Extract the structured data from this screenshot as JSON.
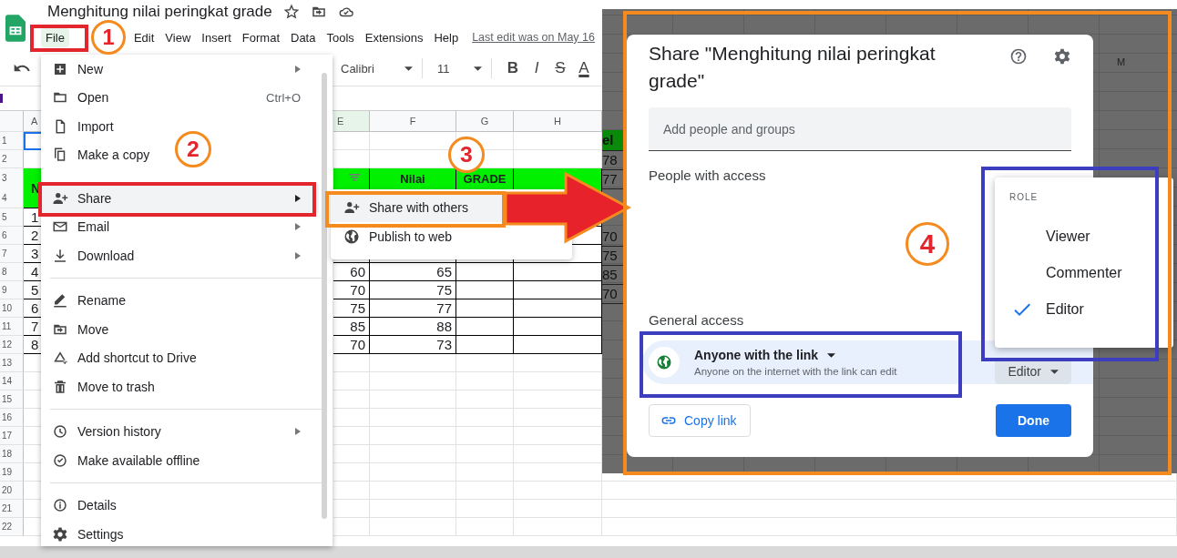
{
  "document": {
    "title": "Menghitung nilai peringkat grade",
    "last_edit": "Last edit was on May 16"
  },
  "menubar": [
    {
      "label": "File",
      "selected": true
    },
    {
      "label": "Edit",
      "selected": false
    },
    {
      "label": "View",
      "selected": false
    },
    {
      "label": "Insert",
      "selected": false
    },
    {
      "label": "Format",
      "selected": false
    },
    {
      "label": "Data",
      "selected": false
    },
    {
      "label": "Tools",
      "selected": false
    },
    {
      "label": "Extensions",
      "selected": false
    },
    {
      "label": "Help",
      "selected": false
    }
  ],
  "toolbar": {
    "font": "Calibri",
    "size": "11",
    "format_buttons": [
      {
        "label": "B",
        "kind": "bold"
      },
      {
        "label": "I",
        "kind": "italic"
      },
      {
        "label": "S",
        "kind": "strike"
      },
      {
        "label": "A",
        "kind": "color"
      }
    ]
  },
  "sheet": {
    "columns": [
      "A",
      "E",
      "F",
      "G",
      "H"
    ],
    "rows": [
      {
        "numbers": [
          "1"
        ],
        "kind": "blank",
        "selected": true,
        "cells": [
          null,
          null,
          null,
          null,
          null
        ]
      },
      {
        "numbers": [
          "2"
        ],
        "kind": "blank",
        "selected": false,
        "cells": [
          null,
          null,
          null,
          null,
          null
        ]
      },
      {
        "numbers": [
          "3",
          "4"
        ],
        "kind": "header",
        "selected": false,
        "filter": true,
        "cells": [
          "N",
          null,
          "Nilai",
          "GRADE",
          null
        ]
      },
      {
        "numbers": [
          "5"
        ],
        "kind": "data",
        "selected": false,
        "cells": [
          "1",
          null,
          null,
          null,
          null
        ]
      },
      {
        "numbers": [
          "6"
        ],
        "kind": "data",
        "selected": false,
        "cells": [
          "2",
          null,
          null,
          null,
          null
        ]
      },
      {
        "numbers": [
          "7"
        ],
        "kind": "data",
        "selected": false,
        "cells": [
          "3",
          null,
          null,
          null,
          null
        ]
      },
      {
        "numbers": [
          "8"
        ],
        "kind": "data",
        "selected": false,
        "cells": [
          "4",
          "60",
          "65",
          null,
          null
        ]
      },
      {
        "numbers": [
          "9"
        ],
        "kind": "data",
        "selected": false,
        "cells": [
          "5",
          "70",
          "75",
          null,
          null
        ]
      },
      {
        "numbers": [
          "10"
        ],
        "kind": "data",
        "selected": false,
        "cells": [
          "6",
          "75",
          "77",
          null,
          null
        ]
      },
      {
        "numbers": [
          "11"
        ],
        "kind": "data",
        "selected": false,
        "cells": [
          "7",
          "85",
          "88",
          null,
          null
        ]
      },
      {
        "numbers": [
          "12"
        ],
        "kind": "data",
        "selected": false,
        "cells": [
          "8",
          "70",
          "73",
          null,
          null
        ]
      },
      {
        "numbers": [
          "13"
        ],
        "kind": "blank",
        "selected": false,
        "cells": [
          null,
          null,
          null,
          null,
          null
        ]
      },
      {
        "numbers": [
          "14"
        ],
        "kind": "blank",
        "selected": false,
        "cells": [
          null,
          null,
          null,
          null,
          null
        ]
      },
      {
        "numbers": [
          "15"
        ],
        "kind": "blank",
        "selected": false,
        "cells": [
          null,
          null,
          null,
          null,
          null
        ]
      },
      {
        "numbers": [
          "16"
        ],
        "kind": "blank",
        "selected": false,
        "cells": [
          null,
          null,
          null,
          null,
          null
        ]
      },
      {
        "numbers": [
          "17"
        ],
        "kind": "blank",
        "selected": false,
        "cells": [
          null,
          null,
          null,
          null,
          null
        ]
      },
      {
        "numbers": [
          "18"
        ],
        "kind": "blank",
        "selected": false,
        "cells": [
          null,
          null,
          null,
          null,
          null
        ]
      },
      {
        "numbers": [
          "19"
        ],
        "kind": "blank",
        "selected": false,
        "cells": [
          null,
          null,
          null,
          null,
          null
        ]
      },
      {
        "numbers": [
          "20"
        ],
        "kind": "blank",
        "selected": false,
        "cells": [
          null,
          null,
          null,
          null,
          null
        ]
      },
      {
        "numbers": [
          "21"
        ],
        "kind": "blank",
        "selected": false,
        "cells": [
          null,
          null,
          null,
          null,
          null
        ]
      },
      {
        "numbers": [
          "22"
        ],
        "kind": "blank",
        "selected": false,
        "cells": [
          null,
          null,
          null,
          null,
          null
        ]
      }
    ]
  },
  "file_menu": [
    {
      "rule": false,
      "items": [
        {
          "label": "New",
          "submenu": true,
          "selected": false
        },
        {
          "label": "Open",
          "shortcut": "Ctrl+O",
          "submenu": false,
          "selected": false
        },
        {
          "label": "Import",
          "submenu": false,
          "selected": false
        },
        {
          "label": "Make a copy",
          "submenu": false,
          "selected": false
        }
      ]
    },
    {
      "rule": false,
      "items": [
        {
          "label": "Share",
          "submenu": true,
          "selected": true
        },
        {
          "label": "Email",
          "submenu": true,
          "selected": false
        },
        {
          "label": "Download",
          "submenu": true,
          "selected": false
        }
      ]
    },
    {
      "rule": true,
      "items": [
        {
          "label": "Rename",
          "submenu": false,
          "selected": false
        },
        {
          "label": "Move",
          "submenu": false,
          "selected": false
        },
        {
          "label": "Add shortcut to Drive",
          "submenu": false,
          "selected": false
        },
        {
          "label": "Move to trash",
          "submenu": false,
          "selected": false
        }
      ]
    },
    {
      "rule": true,
      "items": [
        {
          "label": "Version history",
          "submenu": true,
          "selected": false
        },
        {
          "label": "Make available offline",
          "submenu": false,
          "selected": false
        }
      ]
    },
    {
      "rule": true,
      "items": [
        {
          "label": "Details",
          "submenu": false,
          "selected": false
        },
        {
          "label": "Settings",
          "submenu": false,
          "selected": false
        }
      ]
    }
  ],
  "share_submenu": [
    {
      "label": "Share with others",
      "selected": true
    },
    {
      "label": "Publish to web",
      "selected": false
    }
  ],
  "backdrop": {
    "column_header": "M",
    "cells": [
      "el",
      "78",
      "77",
      null,
      null,
      "70",
      "75",
      "85",
      "70"
    ]
  },
  "dialog": {
    "title": "Share \"Menghitung nilai peringkat grade\"",
    "add_people": {
      "placeholder": "Add people and groups"
    },
    "people_heading": "People with access",
    "general_heading": "General access",
    "access": {
      "label": "Anyone with the link",
      "description": "Anyone on the internet with the link can edit",
      "role": "Editor"
    },
    "role_menu": {
      "heading": "ROLE",
      "items": [
        {
          "label": "Viewer",
          "selected": false
        },
        {
          "label": "Commenter",
          "selected": false
        },
        {
          "label": "Editor",
          "selected": true
        }
      ]
    },
    "copy_link": "Copy link",
    "done": "Done"
  },
  "steps": [
    "1",
    "2",
    "3",
    "4"
  ]
}
